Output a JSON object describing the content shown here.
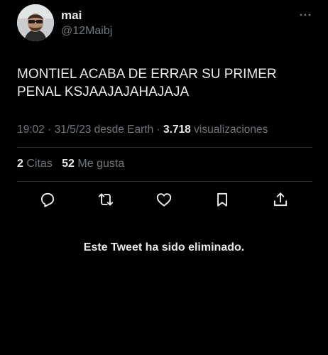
{
  "author": {
    "display_name": "mai",
    "handle": "@12Maibj"
  },
  "tweet": {
    "text_line1": "MONTIEL ACABA DE ERRAR SU PRIMER",
    "text_line2": "PENAL KSJAAJAJAHAJAJA"
  },
  "meta": {
    "time": "19:02",
    "date": "31/5/23",
    "source": "desde Earth",
    "views_count": "3.718",
    "views_label": "visualizaciones",
    "separator": "·"
  },
  "stats": {
    "quotes_count": "2",
    "quotes_label": "Citas",
    "likes_count": "52",
    "likes_label": "Me gusta"
  },
  "actions": {
    "icons": [
      "reply-icon",
      "retweet-icon",
      "like-icon",
      "bookmark-icon",
      "share-icon"
    ]
  },
  "notice": {
    "deleted_text": "Este Tweet ha sido eliminado."
  },
  "colors": {
    "background": "#000000",
    "primary_text": "#e7e9ea",
    "secondary_text": "#71767b",
    "divider": "#2f3336"
  }
}
